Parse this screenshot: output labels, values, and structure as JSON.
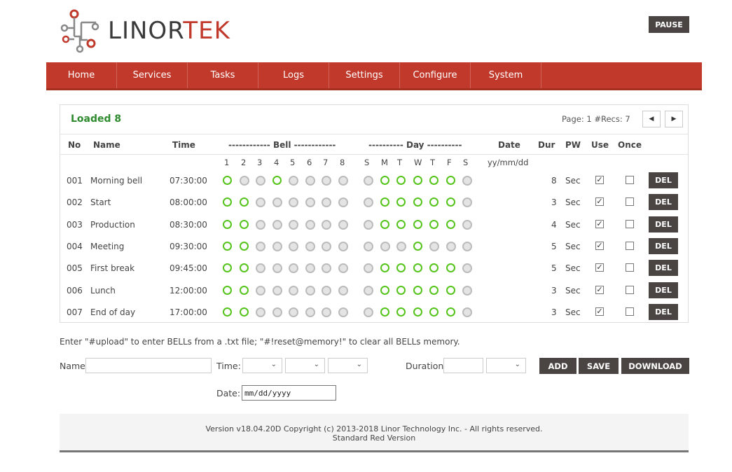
{
  "brand": {
    "text_main": "LINOR",
    "text_accent": "TEK",
    "accent": "#c0392b"
  },
  "pause_label": "PAUSE",
  "nav": [
    "Home",
    "Services",
    "Tasks",
    "Logs",
    "Settings",
    "Configure",
    "System"
  ],
  "panel": {
    "loaded": "Loaded 8",
    "page_info": "Page: 1  #Recs: 7",
    "prev_icon": "chevron-left-icon",
    "next_icon": "chevron-right-icon"
  },
  "columns": {
    "no": "No",
    "name": "Name",
    "time": "Time",
    "bell": "------------ Bell ------------",
    "day": "---------- Day ----------",
    "date": "Date",
    "dur": "Dur",
    "pw": "PW",
    "use": "Use",
    "once": "Once"
  },
  "bell_numbers": [
    "1",
    "2",
    "3",
    "4",
    "5",
    "6",
    "7",
    "8"
  ],
  "day_letters": [
    "S",
    "M",
    "T",
    "W",
    "T",
    "F",
    "S"
  ],
  "date_format": "yy/mm/dd",
  "rows": [
    {
      "no": "001",
      "name": "Morning bell",
      "time": "07:30:00",
      "bells": [
        1,
        0,
        0,
        1,
        0,
        0,
        0,
        0
      ],
      "days": [
        0,
        1,
        1,
        1,
        1,
        1,
        0
      ],
      "date": "",
      "dur": "8",
      "pw": "Sec",
      "use": true,
      "once": false
    },
    {
      "no": "002",
      "name": "Start",
      "time": "08:00:00",
      "bells": [
        1,
        1,
        0,
        0,
        0,
        0,
        0,
        0
      ],
      "days": [
        0,
        1,
        1,
        1,
        1,
        1,
        0
      ],
      "date": "",
      "dur": "3",
      "pw": "Sec",
      "use": true,
      "once": false
    },
    {
      "no": "003",
      "name": "Production",
      "time": "08:30:00",
      "bells": [
        1,
        1,
        0,
        0,
        0,
        0,
        0,
        0
      ],
      "days": [
        0,
        1,
        1,
        1,
        1,
        1,
        0
      ],
      "date": "",
      "dur": "4",
      "pw": "Sec",
      "use": true,
      "once": false
    },
    {
      "no": "004",
      "name": "Meeting",
      "time": "09:30:00",
      "bells": [
        1,
        1,
        0,
        0,
        0,
        0,
        0,
        0
      ],
      "days": [
        0,
        0,
        0,
        1,
        0,
        0,
        0
      ],
      "date": "",
      "dur": "5",
      "pw": "Sec",
      "use": true,
      "once": false
    },
    {
      "no": "005",
      "name": "First break",
      "time": "09:45:00",
      "bells": [
        1,
        1,
        0,
        0,
        0,
        0,
        0,
        0
      ],
      "days": [
        0,
        1,
        1,
        1,
        1,
        1,
        0
      ],
      "date": "",
      "dur": "5",
      "pw": "Sec",
      "use": true,
      "once": false
    },
    {
      "no": "006",
      "name": "Lunch",
      "time": "12:00:00",
      "bells": [
        1,
        1,
        0,
        0,
        0,
        0,
        0,
        0
      ],
      "days": [
        0,
        1,
        1,
        1,
        1,
        1,
        0
      ],
      "date": "",
      "dur": "3",
      "pw": "Sec",
      "use": true,
      "once": false
    },
    {
      "no": "007",
      "name": "End of day",
      "time": "17:00:00",
      "bells": [
        1,
        1,
        0,
        0,
        0,
        0,
        0,
        0
      ],
      "days": [
        0,
        1,
        1,
        1,
        1,
        1,
        0
      ],
      "date": "",
      "dur": "3",
      "pw": "Sec",
      "use": true,
      "once": false
    }
  ],
  "del_label": "DEL",
  "hint": "Enter \"#upload\" to enter BELLs from a .txt file; \"#!reset@memory!\" to clear all BELLs memory.",
  "form": {
    "name_label": "Name:",
    "name_value": "",
    "time_label": "Time:",
    "duration_label": "Duration:",
    "duration_value": "",
    "date_label": "Date:",
    "date_placeholder": "mm/dd/yyyy",
    "add_label": "ADD",
    "save_label": "SAVE",
    "download_label": "DOWNLOAD"
  },
  "footer": {
    "line1": "Version v18.04.20D Copyright (c) 2013-2018 Linor Technology Inc. - All rights reserved.",
    "line2": "Standard Red Version"
  },
  "colors": {
    "on": "#55c41a",
    "off": "#bbbbbb",
    "nav": "#c0392b",
    "button": "#4a4442",
    "loaded": "#2e8b2e"
  }
}
